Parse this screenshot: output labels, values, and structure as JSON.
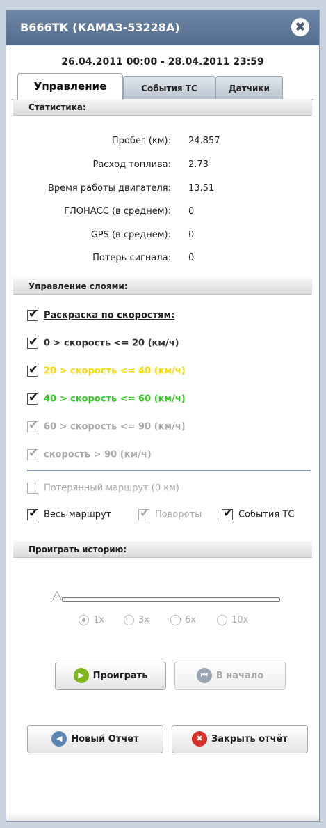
{
  "window": {
    "title": "В666ТК (КАМАЗ-53228А)",
    "close_symbol": "✖"
  },
  "date_range": "26.04.2011 00:00 - 28.04.2011 23:59",
  "tabs": [
    {
      "label": "Управление",
      "active": true
    },
    {
      "label": "События ТС",
      "active": false
    },
    {
      "label": "Датчики",
      "active": false
    }
  ],
  "statistics": {
    "heading": "Статистика:",
    "rows": [
      {
        "label": "Пробег (км):",
        "value": "24.857"
      },
      {
        "label": "Расход топлива:",
        "value": "2.73"
      },
      {
        "label": "Время работы двигателя:",
        "value": "13.51"
      },
      {
        "label": "ГЛОНАСС (в среднем):",
        "value": "0"
      },
      {
        "label": "GPS (в среднем):",
        "value": "0"
      },
      {
        "label": "Потерь сигнала:",
        "value": "0"
      }
    ]
  },
  "layers": {
    "heading": "Управление слоями:",
    "speed_coloring": {
      "label": "Раскраска по скоростям:",
      "checked": true
    },
    "speed_ranges": [
      {
        "label": "0 > скорость <= 20 (км/ч)",
        "checked": true,
        "color": "#333333"
      },
      {
        "label": "20 > скорость <= 40 (км/ч)",
        "checked": true,
        "color": "#ffd700"
      },
      {
        "label": "40 > скорость <= 60 (км/ч)",
        "checked": true,
        "color": "#33cc22"
      },
      {
        "label": "60 > скорость <= 90 (км/ч)",
        "checked": true,
        "color": "#aaaaaa"
      },
      {
        "label": "скорость > 90 (км/ч)",
        "checked": true,
        "color": "#aaaaaa"
      }
    ],
    "lost_route": {
      "label": "Потерянный маршрут (0 км)",
      "checked": false
    },
    "whole_route": {
      "label": "Весь маршрут",
      "checked": true
    },
    "turns": {
      "label": "Повороты",
      "checked": true
    },
    "vehicle_events": {
      "label": "События ТС",
      "checked": true
    }
  },
  "playback": {
    "heading": "Проиграть историю:",
    "slider_position": 0,
    "speeds": [
      {
        "label": "1x",
        "selected": true
      },
      {
        "label": "3x",
        "selected": false
      },
      {
        "label": "6x",
        "selected": false
      },
      {
        "label": "10x",
        "selected": false
      }
    ],
    "play_label": "Проиграть",
    "rewind_label": "В начало"
  },
  "actions": {
    "new_report_label": "Новый Отчет",
    "close_report_label": "Закрыть отчёт"
  },
  "colors": {
    "title_bar": "#5f7899",
    "play_icon": "#7fb81e",
    "rewind_icon": "#9aa6b2",
    "new_report_icon": "#5b84b0",
    "close_report_icon": "#d8302a"
  }
}
